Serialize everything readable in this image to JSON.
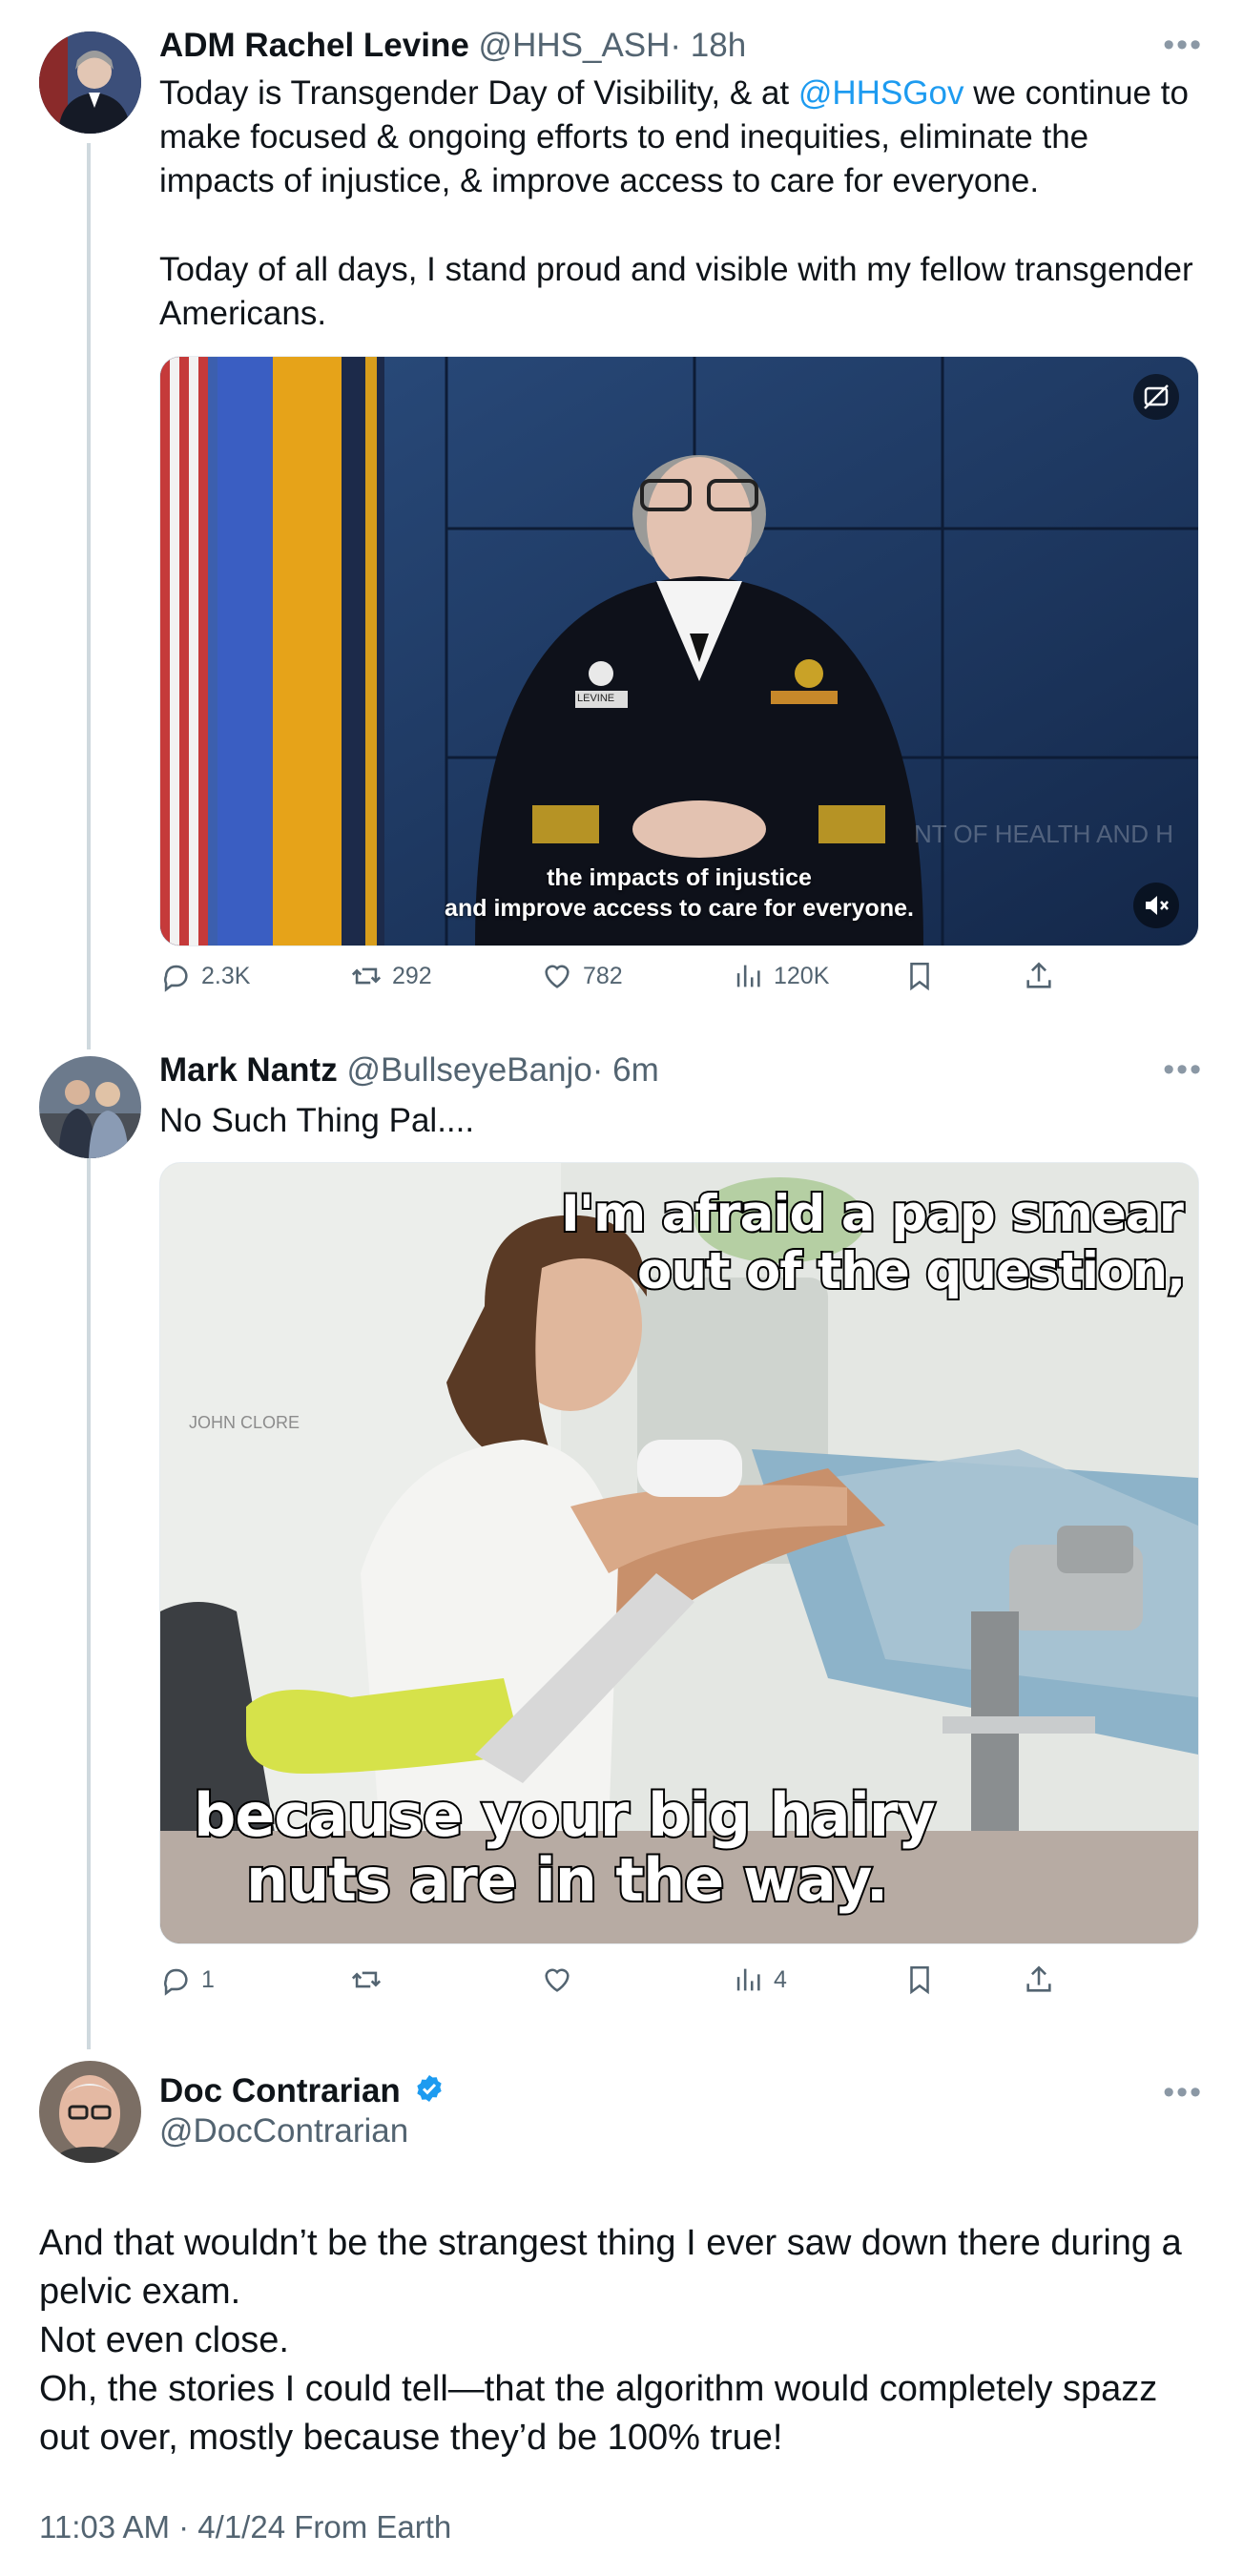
{
  "tweets": [
    {
      "name": "ADM Rachel Levine",
      "handle": "@HHS_ASH",
      "time": "· 18h",
      "text_pre": "Today is Transgender Day of Visibility, & at ",
      "mention": "@HHSGov",
      "text_post": " we continue to make focused & ongoing efforts to end inequities, eliminate the impacts of injustice, & improve access to care for everyone.",
      "text_2": "Today of all days, I stand proud and visible with my fellow transgender Americans.",
      "media": {
        "caption_1": "the impacts of injustice",
        "caption_2": "and improve access to care for everyone.",
        "nametag": "LEVINE",
        "backdrop_text": "NT OF HEALTH AND H"
      },
      "stats": {
        "replies": "2.3K",
        "reposts": "292",
        "likes": "782",
        "views": "120K"
      }
    },
    {
      "name": "Mark Nantz",
      "handle": "@BullseyeBanjo",
      "time": "· 6m",
      "text": "No Such Thing Pal....",
      "media": {
        "top_line_1": "I'm afraid a pap smear is",
        "top_line_2": "out of the question,",
        "bottom_line_1": "because your big hairy",
        "bottom_line_2": "nuts are in the way.",
        "watermark": "JOHN CLORE"
      },
      "stats": {
        "replies": "1",
        "reposts": "",
        "likes": "",
        "views": "4"
      }
    }
  ],
  "main_post": {
    "name": "Doc Contrarian",
    "handle": "@DocContrarian",
    "lines": [
      "And that wouldn’t be the strangest thing I ever saw down there during a pelvic exam.",
      "Not even close.",
      "Oh, the stories I could tell—that the algorithm would completely spazz out over, mostly because they’d be 100% true!"
    ],
    "timestamp": "11:03 AM · 4/1/24 From Earth"
  },
  "more_glyph": "•••",
  "colors": {
    "link": "#1d9bf0",
    "muted": "#536471",
    "verified": "#1d9bf0",
    "thread_line": "#cfd9de"
  }
}
